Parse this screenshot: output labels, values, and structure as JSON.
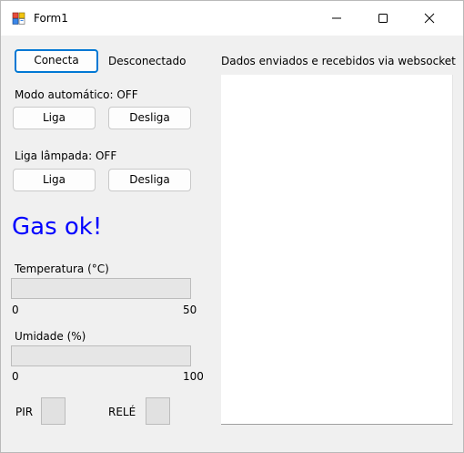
{
  "window": {
    "title": "Form1",
    "icon": "winforms-app-icon",
    "controls": [
      "minimize-icon",
      "maximize-icon",
      "close-icon"
    ]
  },
  "connection": {
    "connect_label": "Conecta",
    "status": "Desconectado"
  },
  "auto_mode": {
    "label": "Modo automático: OFF",
    "on_label": "Liga",
    "off_label": "Desliga"
  },
  "lamp": {
    "label": "Liga lâmpada: OFF",
    "on_label": "Liga",
    "off_label": "Desliga"
  },
  "gas": {
    "status": "Gas ok!",
    "color": "#0000ff"
  },
  "temperature": {
    "label": "Temperatura (°C)",
    "min": "0",
    "max": "50",
    "value_fraction": 0
  },
  "humidity": {
    "label": "Umidade (%)",
    "min": "0",
    "max": "100",
    "value_fraction": 0
  },
  "indicators": {
    "pir_label": "PIR",
    "relay_label": "RELÉ"
  },
  "log": {
    "title": "Dados enviados e recebidos via websocket",
    "content": ""
  }
}
